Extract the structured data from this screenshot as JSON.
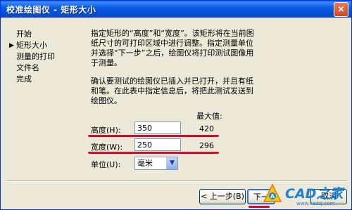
{
  "window": {
    "title": "校准绘图仪 - 矩形大小",
    "close_glyph": "×"
  },
  "nav": {
    "current_marker": "▶",
    "items": [
      "开始",
      "矩形大小",
      "测量的打印",
      "文件名",
      "完成"
    ],
    "active_index": 1
  },
  "instructions": {
    "para1": "指定矩形的“高度”和“宽度”。该矩形将在当前图纸尺寸的可打印区域中进行调整。指定测量单位并选择“下一步”之后，绘图仪将打印测试图像用于测量。",
    "para2": "确认要测试的绘图仪已插入并已打开，并且有纸和笔。在此表中指定信息后，将把此测试发送到绘图仪。"
  },
  "form": {
    "max_label": "最大值:",
    "height_label": "高度(H):",
    "height_value": "350",
    "height_max": "420",
    "width_label": "宽度(W):",
    "width_value": "250",
    "width_max": "296",
    "unit_label": "单位(U):",
    "unit_value": "毫米"
  },
  "buttons": {
    "back": "< 上一步(B)",
    "next": "下一",
    "cancel": "取消"
  },
  "watermark": {
    "text": "CAD之家",
    "url": "www.cadzj.com"
  },
  "colors": {
    "annotation_underline": "#c8102e",
    "titlebar": "#0b5ce6"
  }
}
